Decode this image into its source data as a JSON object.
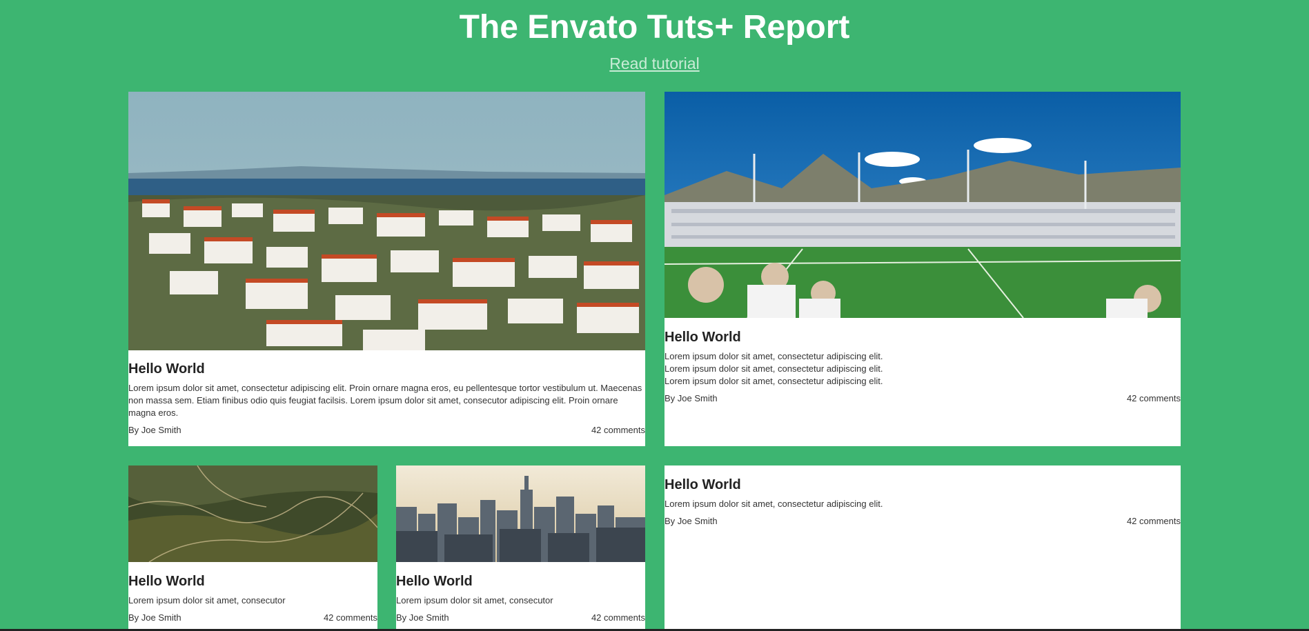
{
  "header": {
    "title": "The Envato Tuts+ Report",
    "link_label": "Read tutorial"
  },
  "cards": [
    {
      "image": "coastal-town-photo",
      "title": "Hello World",
      "text": "Lorem ipsum dolor sit amet, consectetur adipiscing elit. Proin ornare magna eros, eu pellentesque tortor vestibulum ut. Maecenas non massa sem. Etiam finibus odio quis feugiat facilsis. Lorem ipsum dolor sit amet, consecutor adipiscing elit. Proin ornare magna eros.",
      "author": "By Joe Smith",
      "comments": "42 comments"
    },
    {
      "image": "football-stadium-photo",
      "title": "Hello World",
      "text": "Lorem ipsum dolor sit amet, consectetur adipiscing elit. Lorem ipsum dolor sit amet, consectetur adipiscing elit. Lorem ipsum dolor sit amet, consectetur adipiscing elit.",
      "author": "By Joe Smith",
      "comments": "42 comments"
    },
    {
      "image": "aerial-landscape-photo",
      "title": "Hello World",
      "text": "Lorem ipsum dolor sit amet, consecutor",
      "author": "By Joe Smith",
      "comments": "42 comments"
    },
    {
      "image": "city-skyline-photo",
      "title": "Hello World",
      "text": "Lorem ipsum dolor sit amet, consecutor",
      "author": "By Joe Smith",
      "comments": "42 comments"
    },
    {
      "title": "Hello World",
      "text": "Lorem ipsum dolor sit amet, consectetur adipiscing elit.",
      "author": "By Joe Smith",
      "comments": "42 comments"
    }
  ],
  "colors": {
    "background": "#3db571",
    "card": "#ffffff",
    "link": "#c9ecd6"
  }
}
